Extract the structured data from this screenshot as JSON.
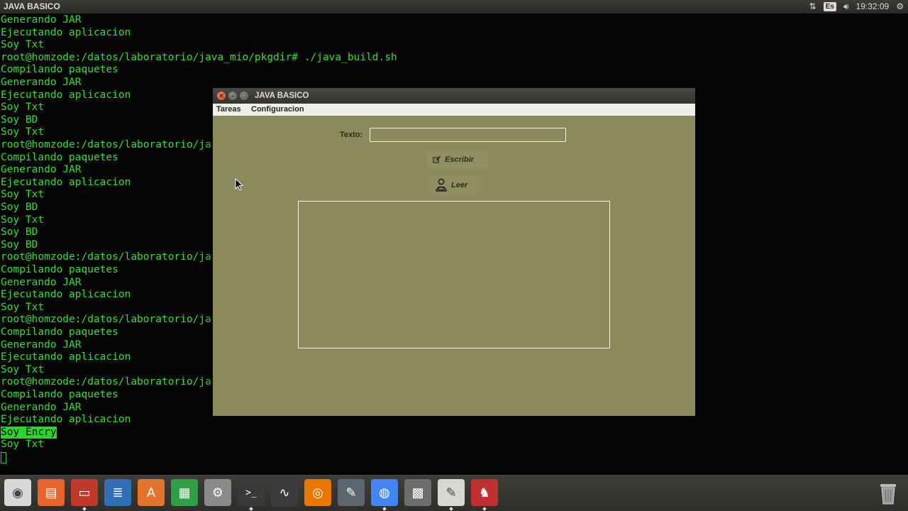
{
  "top_panel": {
    "title": "JAVA BASICO",
    "keyboard_layout": "Es",
    "clock": "19:32:09"
  },
  "terminal": {
    "lines": [
      {
        "text": "Generando JAR"
      },
      {
        "text": "Ejecutando aplicacion"
      },
      {
        "text": "Soy Txt"
      },
      {
        "text": "root@homzode:/datos/laboratorio/java_mio/pkgdir# ./java_build.sh"
      },
      {
        "text": "Compilando paquetes"
      },
      {
        "text": "Generando JAR"
      },
      {
        "text": "Ejecutando aplicacion"
      },
      {
        "text": "Soy Txt"
      },
      {
        "text": "Soy BD"
      },
      {
        "text": "Soy Txt"
      },
      {
        "text": "root@homzode:/datos/laboratorio/ja"
      },
      {
        "text": "Compilando paquetes"
      },
      {
        "text": "Generando JAR"
      },
      {
        "text": "Ejecutando aplicacion"
      },
      {
        "text": "Soy Txt"
      },
      {
        "text": "Soy BD"
      },
      {
        "text": "Soy Txt"
      },
      {
        "text": "Soy BD"
      },
      {
        "text": "Soy BD"
      },
      {
        "text": "root@homzode:/datos/laboratorio/ja"
      },
      {
        "text": "Compilando paquetes"
      },
      {
        "text": "Generando JAR"
      },
      {
        "text": "Ejecutando aplicacion"
      },
      {
        "text": "Soy Txt"
      },
      {
        "text": "root@homzode:/datos/laboratorio/ja"
      },
      {
        "text": "Compilando paquetes"
      },
      {
        "text": "Generando JAR"
      },
      {
        "text": "Ejecutando aplicacion"
      },
      {
        "text": "Soy Txt"
      },
      {
        "text": "root@homzode:/datos/laboratorio/ja"
      },
      {
        "text": "Compilando paquetes"
      },
      {
        "text": "Generando JAR"
      },
      {
        "text": "Ejecutando aplicacion"
      },
      {
        "text": "Soy Encry",
        "highlight": true
      },
      {
        "text": "Soy Txt"
      }
    ]
  },
  "java_window": {
    "title": "JAVA BASICO",
    "menu": [
      "Tareas",
      "Configuracion"
    ],
    "texto_label": "Texto:",
    "texto_value": "",
    "escribir_label": "Escribir",
    "leer_label": "Leer",
    "text_area_value": ""
  },
  "dock": {
    "items": [
      {
        "name": "dash-button",
        "icon": "ubuntu-logo-icon",
        "color": "#d8d8d8",
        "running": false
      },
      {
        "name": "dock-item-presentation",
        "icon": "presentation-icon",
        "color": "#e8642c",
        "running": false
      },
      {
        "name": "dock-item-files",
        "icon": "file-cabinet-icon",
        "color": "#c0392b",
        "running": true
      },
      {
        "name": "dock-item-writer",
        "icon": "writer-document-icon",
        "color": "#2f6fb5",
        "running": false
      },
      {
        "name": "dock-item-software-center",
        "icon": "software-center-icon",
        "color": "#e2742e",
        "running": false
      },
      {
        "name": "dock-item-calc",
        "icon": "spreadsheet-icon",
        "color": "#2f9e44",
        "running": false
      },
      {
        "name": "dock-item-settings",
        "icon": "system-settings-icon",
        "color": "#8a8a8a",
        "running": false
      },
      {
        "name": "dock-item-terminal",
        "icon": "terminal-icon",
        "color": "#3a3a3a",
        "running": true
      },
      {
        "name": "dock-item-system-monitor",
        "icon": "system-monitor-icon",
        "color": "#3c3c3c",
        "running": false
      },
      {
        "name": "dock-item-blender",
        "icon": "blender-icon",
        "color": "#ea7600",
        "running": false
      },
      {
        "name": "dock-item-graphics-tool",
        "icon": "graphics-pen-icon",
        "color": "#5c6670",
        "running": false
      },
      {
        "name": "dock-item-chrome",
        "icon": "chrome-icon",
        "color": "#4285f4",
        "running": true
      },
      {
        "name": "dock-item-calculator",
        "icon": "calculator-icon",
        "color": "#6d6d6d",
        "running": false
      },
      {
        "name": "dock-item-text-editor",
        "icon": "text-editor-icon",
        "color": "#d8d8d0",
        "running": true
      },
      {
        "name": "dock-item-java",
        "icon": "java-duke-icon",
        "color": "#c03030",
        "running": true
      }
    ]
  }
}
